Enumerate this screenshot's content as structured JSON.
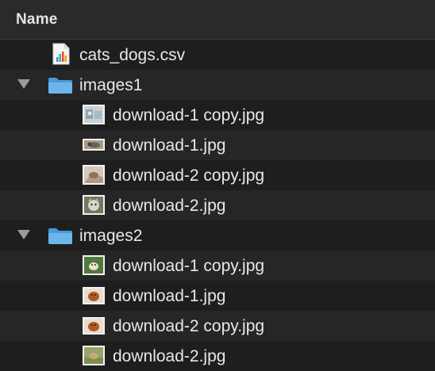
{
  "header": {
    "name_label": "Name"
  },
  "rows": [
    {
      "label": "cats_dogs.csv",
      "icon": "csv-file-icon"
    },
    {
      "label": "images1",
      "icon": "folder-icon",
      "expanded": true
    },
    {
      "label": "download-1 copy.jpg",
      "icon": "image-thumbnail-icon"
    },
    {
      "label": "download-1.jpg",
      "icon": "image-thumbnail-icon"
    },
    {
      "label": "download-2 copy.jpg",
      "icon": "image-thumbnail-icon"
    },
    {
      "label": "download-2.jpg",
      "icon": "image-thumbnail-icon"
    },
    {
      "label": "images2",
      "icon": "folder-icon",
      "expanded": true
    },
    {
      "label": "download-1 copy.jpg",
      "icon": "image-thumbnail-icon"
    },
    {
      "label": "download-1.jpg",
      "icon": "image-thumbnail-icon"
    },
    {
      "label": "download-2 copy.jpg",
      "icon": "image-thumbnail-icon"
    },
    {
      "label": "download-2.jpg",
      "icon": "image-thumbnail-icon"
    }
  ],
  "colors": {
    "background": "#1e1e1e",
    "row_stripe": "#262626",
    "header": "#2a2a2a",
    "text": "#e8e8e8",
    "folder_blue": "#5aa8e0"
  }
}
